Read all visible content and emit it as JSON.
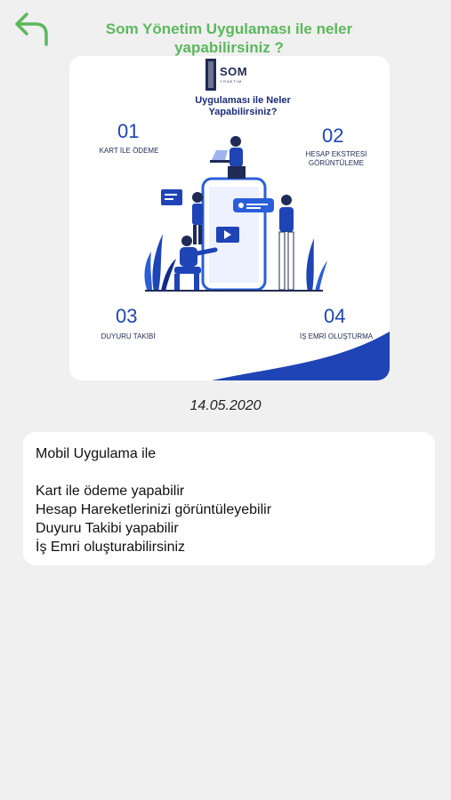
{
  "header": {
    "title": "Som Yönetim Uygulaması ile neler yapabilirsiniz ?",
    "accent_color": "#5cb85c",
    "back_icon": "back-arrow-icon"
  },
  "image_card": {
    "logo_text": "SOM",
    "logo_subtext": "YÖNETİM",
    "heading_line1": "Uygulaması ile Neler",
    "heading_line2": "Yapabilirsiniz?",
    "features": [
      {
        "number": "01",
        "label": "KART İLE ÖDEME"
      },
      {
        "number": "02",
        "label_line1": "HESAP EKSTRESİ",
        "label_line2": "GÖRÜNTÜLEME"
      },
      {
        "number": "03",
        "label": "DUYURU TAKİBİ"
      },
      {
        "number": "04",
        "label": "İŞ EMRİ OLUŞTURMA"
      }
    ],
    "brand_color": "#1f44b6"
  },
  "date": "14.05.2020",
  "message": {
    "intro": "Mobil Uygulama ile",
    "lines": [
      "Kart ile ödeme yapabilir",
      "Hesap Hareketlerinizi görüntüleyebilir",
      "Duyuru Takibi yapabilir",
      "İş Emri oluşturabilirsiniz"
    ]
  }
}
